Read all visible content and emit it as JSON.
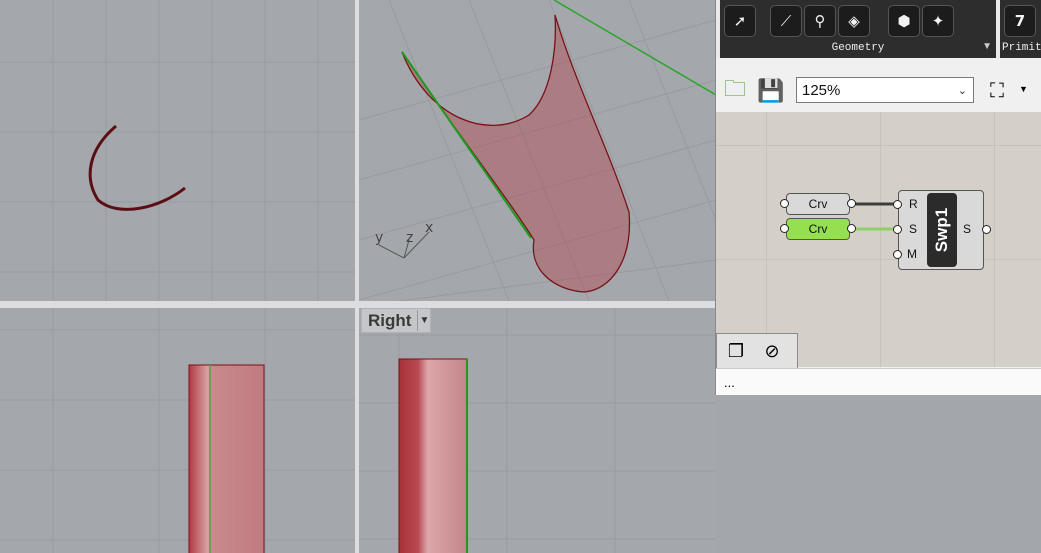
{
  "viewports": {
    "right_label": "Right",
    "axis_labels": {
      "x": "x",
      "y": "y",
      "z": "z"
    }
  },
  "grasshopper": {
    "ribbon": {
      "group_label": "Geometry",
      "next_group_label": "Primiti",
      "icons": [
        "vector-icon",
        "curve-icon",
        "line-icon",
        "surface-icon",
        "mesh-icon",
        "sweep-icon",
        "num-7-icon"
      ]
    },
    "toolbar": {
      "zoom_value": "125%"
    },
    "nodes": {
      "param1_label": "Crv",
      "param2_label": "Crv",
      "component_nickname": "Swp1",
      "inputs": [
        "R",
        "S",
        "M"
      ],
      "output": "S"
    },
    "status_text": "...",
    "colors": {
      "wire_dark": "#3d3d3d",
      "wire_green": "#8fcf6a",
      "param_selected": "#95e04f",
      "surface_red": "#b04a50"
    }
  }
}
